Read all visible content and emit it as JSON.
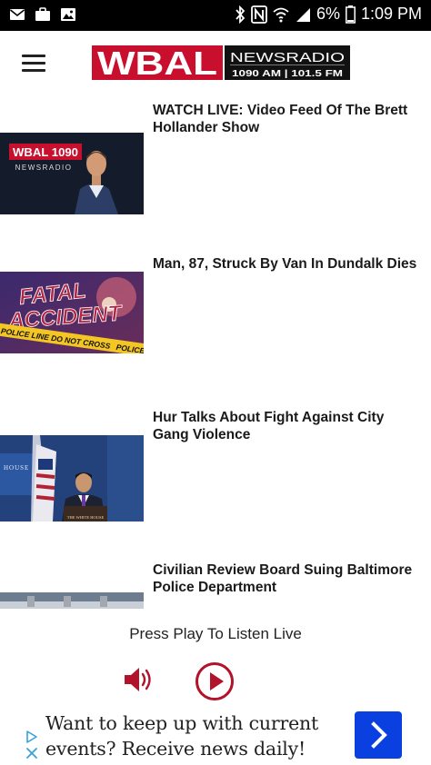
{
  "status_bar": {
    "battery": "6%",
    "time": "1:09 PM",
    "icons": [
      "mail-icon",
      "briefcase-icon",
      "image-icon",
      "bluetooth-icon",
      "nfc-icon",
      "wifi-icon",
      "signal-icon",
      "battery-icon"
    ]
  },
  "header": {
    "logo": {
      "brand": "WBAL",
      "line1": "NEWSRADIO",
      "line2": "1090 AM | 101.5 FM"
    },
    "colors": {
      "brand_red": "#c8102e",
      "logo_black": "#111111"
    }
  },
  "articles": [
    {
      "headline": "WATCH LIVE: Video Feed Of The Brett Hollander Show",
      "thumb_badge": "WBAL 1090",
      "thumb_sub": "NEWSRADIO"
    },
    {
      "headline": "Man, 87, Struck By Van In Dundalk Dies",
      "thumb_line1": "FATAL",
      "thumb_line2": "ACCIDENT",
      "thumb_tape1": "POLICE LINE DO NOT CROSS",
      "thumb_tape2": "POLICE"
    },
    {
      "headline": "Hur Talks About Fight Against City Gang Violence",
      "thumb_sign": "HOUSE",
      "thumb_podium": "THE WHITE HOUSE"
    },
    {
      "headline": "Civilian Review Board Suing Baltimore Police Department"
    }
  ],
  "player": {
    "label": "Press Play To Listen Live",
    "accent": "#b2132a"
  },
  "ad": {
    "text": "Want to keep up with current events? Receive news daily!",
    "cta_color": "#0a3fe0"
  }
}
